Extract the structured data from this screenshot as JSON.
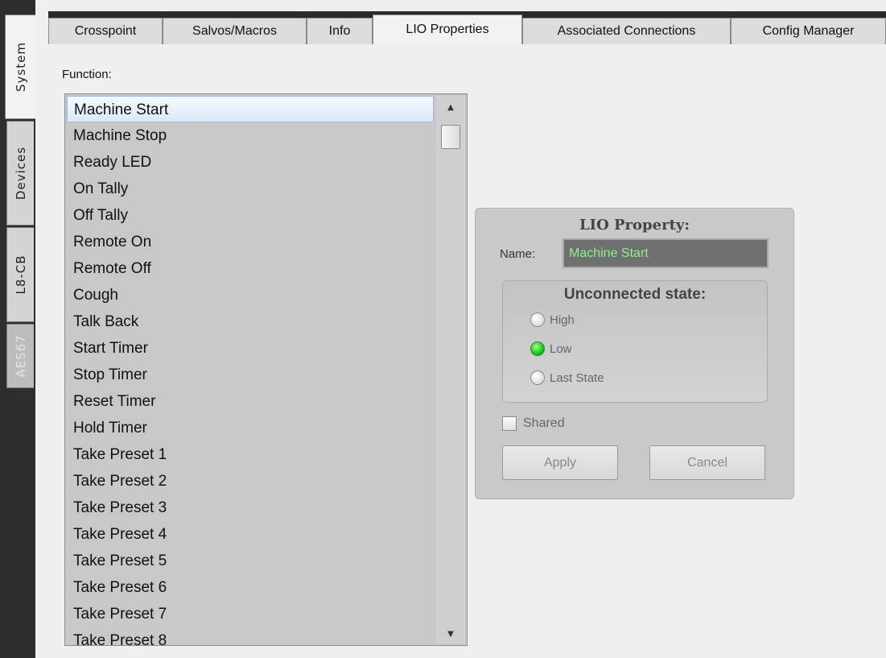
{
  "sidebar": {
    "tabs": [
      {
        "label": "System",
        "state": "active"
      },
      {
        "label": "Devices",
        "state": "normal"
      },
      {
        "label": "L8-CB",
        "state": "normal"
      },
      {
        "label": "AES67",
        "state": "disabled"
      }
    ]
  },
  "tabs": [
    {
      "label": "Crosspoint"
    },
    {
      "label": "Salvos/Macros"
    },
    {
      "label": "Info"
    },
    {
      "label": "LIO Properties",
      "active": true
    },
    {
      "label": "Associated Connections"
    },
    {
      "label": "Config Manager"
    }
  ],
  "function_list": {
    "label": "Function:",
    "items": [
      "Machine Start",
      "Machine Stop",
      "Ready LED",
      "On Tally",
      "Off Tally",
      "Remote On",
      "Remote Off",
      "Cough",
      "Talk Back",
      "Start Timer",
      "Stop Timer",
      "Reset Timer",
      "Hold Timer",
      "Take Preset 1",
      "Take Preset 2",
      "Take Preset 3",
      "Take Preset 4",
      "Take Preset 5",
      "Take Preset 6",
      "Take Preset 7",
      "Take Preset 8"
    ],
    "selected_index": 0
  },
  "lio_property": {
    "title": "LIO Property:",
    "name_label": "Name:",
    "name_value": "Machine Start",
    "unconnected_state": {
      "title": "Unconnected state:",
      "options": [
        "High",
        "Low",
        "Last State"
      ],
      "selected": "Low"
    },
    "shared_label": "Shared",
    "shared_checked": false,
    "apply_label": "Apply",
    "cancel_label": "Cancel"
  },
  "icons": {
    "scroll_up": "chevron-up-icon",
    "scroll_down": "chevron-down-icon"
  },
  "colors": {
    "name_text": "#8cf08c",
    "radio_selected": "#1dbf1d",
    "selection_bg": "#dde9f7"
  }
}
